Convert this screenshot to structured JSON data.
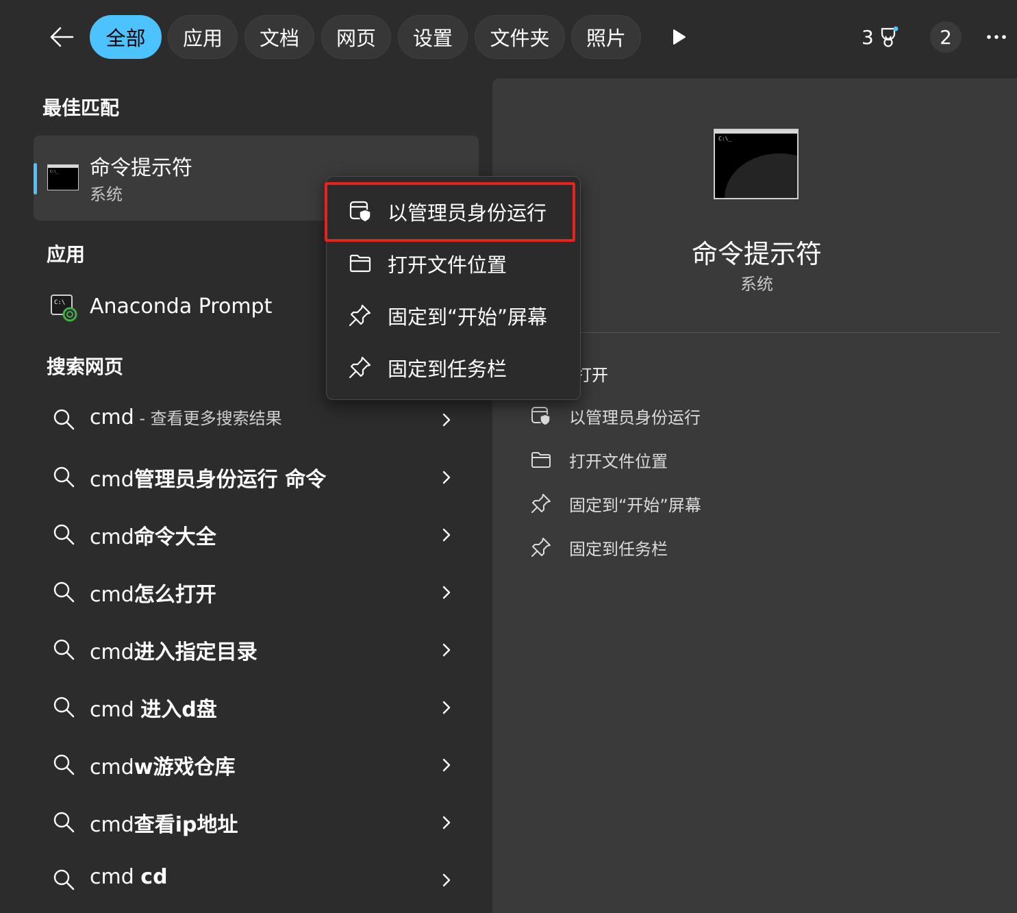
{
  "tabs": [
    {
      "label": "全部",
      "active": true
    },
    {
      "label": "应用",
      "active": false
    },
    {
      "label": "文档",
      "active": false
    },
    {
      "label": "网页",
      "active": false
    },
    {
      "label": "设置",
      "active": false
    },
    {
      "label": "文件夹",
      "active": false
    },
    {
      "label": "照片",
      "active": false
    }
  ],
  "header": {
    "points": "3",
    "avatar_text": "2",
    "icons": {
      "back": "back-arrow-icon",
      "play": "play-icon",
      "rewards": "trophy-icon",
      "more": "more-icon"
    }
  },
  "best_match": {
    "section_title": "最佳匹配",
    "title": "命令提示符",
    "subtitle": "系统",
    "icon": "command-prompt-icon"
  },
  "apps": {
    "section_title": "应用",
    "items": [
      {
        "label": "Anaconda Prompt",
        "icon": "anaconda-prompt-icon"
      }
    ]
  },
  "web": {
    "section_title": "搜索网页",
    "items": [
      {
        "prefix": "cmd",
        "bold": "",
        "hint": " - 查看更多搜索结果"
      },
      {
        "prefix": "cmd",
        "bold": "管理员身份运行 命令",
        "hint": ""
      },
      {
        "prefix": "cmd",
        "bold": "命令大全",
        "hint": ""
      },
      {
        "prefix": "cmd",
        "bold": "怎么打开",
        "hint": ""
      },
      {
        "prefix": "cmd",
        "bold": "进入指定目录",
        "hint": ""
      },
      {
        "prefix": "cmd ",
        "bold": "进入d盘",
        "hint": ""
      },
      {
        "prefix": "cmd",
        "bold": "w游戏仓库",
        "hint": ""
      },
      {
        "prefix": "cmd",
        "bold": "查看ip地址",
        "hint": ""
      },
      {
        "prefix": "cmd ",
        "bold": "cd",
        "hint": ""
      }
    ]
  },
  "context_menu": {
    "items": [
      {
        "label": "以管理员身份运行",
        "icon": "shield-window-icon",
        "highlighted": true
      },
      {
        "label": "打开文件位置",
        "icon": "folder-icon",
        "highlighted": false
      },
      {
        "label": "固定到“开始”屏幕",
        "icon": "pin-icon",
        "highlighted": false
      },
      {
        "label": "固定到任务栏",
        "icon": "pin-icon",
        "highlighted": false
      }
    ],
    "highlight_color": "#e8231e"
  },
  "detail": {
    "title": "命令提示符",
    "subtitle": "系统",
    "open_label": "打开",
    "actions": [
      {
        "label": "以管理员身份运行",
        "icon": "shield-window-icon"
      },
      {
        "label": "打开文件位置",
        "icon": "folder-icon"
      },
      {
        "label": "固定到“开始”屏幕",
        "icon": "pin-icon"
      },
      {
        "label": "固定到任务栏",
        "icon": "pin-icon"
      }
    ]
  },
  "colors": {
    "accent": "#4cc2ff",
    "background": "#2c2c2c",
    "pane": "#3a3a3a"
  }
}
